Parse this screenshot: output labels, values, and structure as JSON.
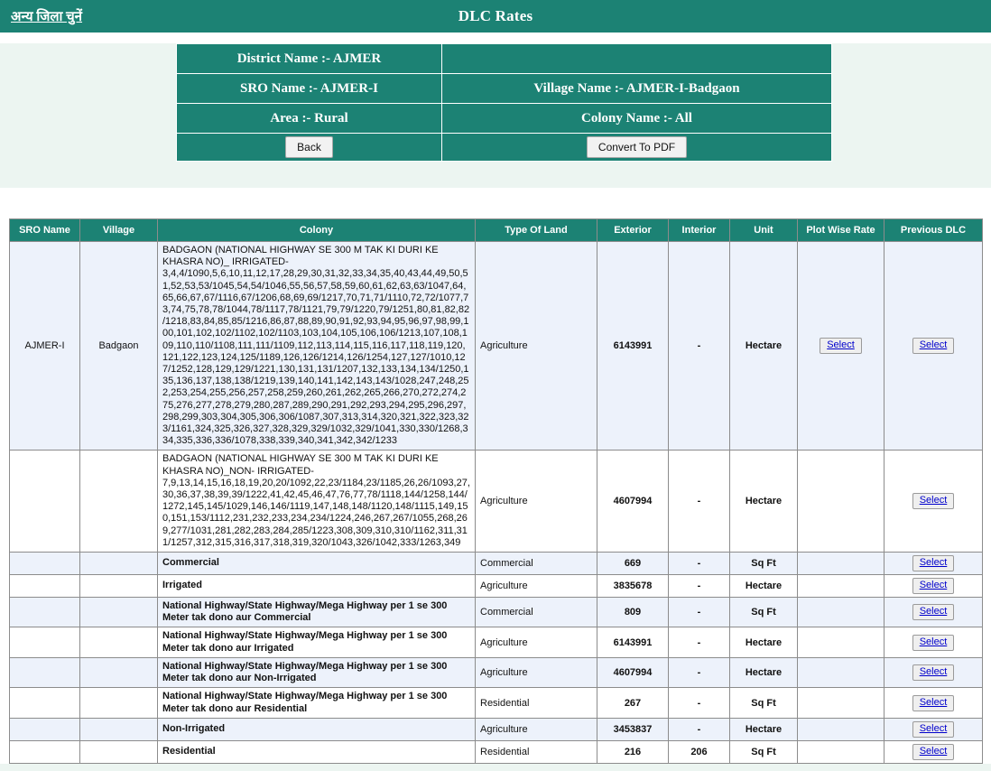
{
  "header": {
    "district_link": "अन्य जिला चुनें",
    "title": "DLC Rates"
  },
  "info": {
    "district": "District Name :- AJMER",
    "blank": "",
    "sro": "SRO Name :- AJMER-I",
    "village": "Village Name :- AJMER-I-Badgaon",
    "area": "Area :- Rural",
    "colony": "Colony Name :- All",
    "back_label": "Back",
    "pdf_label": "Convert To PDF"
  },
  "table": {
    "columns": [
      "SRO Name",
      "Village",
      "Colony",
      "Type Of Land",
      "Exterior",
      "Interior",
      "Unit",
      "Plot Wise Rate",
      "Previous DLC"
    ],
    "select_label": "Select",
    "rows": [
      {
        "sro": "AJMER-I",
        "village": "Badgaon",
        "colony": "BADGAON (NATIONAL HIGHWAY SE 300 M TAK KI DURI KE KHASRA NO)_ IRRIGATED-3,4,4/1090,5,6,10,11,12,17,28,29,30,31,32,33,34,35,40,43,44,49,50,51,52,53,53/1045,54,54/1046,55,56,57,58,59,60,61,62,63,63/1047,64,65,66,67,67/1116,67/1206,68,69,69/1217,70,71,71/1110,72,72/1077,73,74,75,78,78/1044,78/1117,78/1121,79,79/1220,79/1251,80,81,82,82/1218,83,84,85,85/1216,86,87,88,89,90,91,92,93,94,95,96,97,98,99,100,101,102,102/1102,102/1103,103,104,105,106,106/1213,107,108,109,110,110/1108,111,111/1109,112,113,114,115,116,117,118,119,120,121,122,123,124,125/1189,126,126/1214,126/1254,127,127/1010,127/1252,128,129,129/1221,130,131,131/1207,132,133,134,134/1250,135,136,137,138,138/1219,139,140,141,142,143,143/1028,247,248,252,253,254,255,256,257,258,259,260,261,262,265,266,270,272,274,275,276,277,278,279,280,287,289,290,291,292,293,294,295,296,297,298,299,303,304,305,306,306/1087,307,313,314,320,321,322,323,323/1161,324,325,326,327,328,329,329/1032,329/1041,330,330/1268,334,335,336,336/1078,338,339,340,341,342,342/1233",
        "type": "Agriculture",
        "exterior": "6143991",
        "interior": "-",
        "unit": "Hectare",
        "plot_wise_rate": "Select",
        "previous_dlc": "Select",
        "long": true
      },
      {
        "sro": "",
        "village": "",
        "colony": "BADGAON (NATIONAL HIGHWAY SE 300 M TAK KI DURI KE KHASRA NO)_NON- IRRIGATED-7,9,13,14,15,16,18,19,20,20/1092,22,23/1184,23/1185,26,26/1093,27,30,36,37,38,39,39/1222,41,42,45,46,47,76,77,78/1118,144/1258,144/1272,145,145/1029,146,146/1119,147,148,148/1120,148/1115,149,150,151,153/1112,231,232,233,234,234/1224,246,267,267/1055,268,269,277/1031,281,282,283,284,285/1223,308,309,310,310/1162,311,311/1257,312,315,316,317,318,319,320/1043,326/1042,333/1263,349",
        "type": "Agriculture",
        "exterior": "4607994",
        "interior": "-",
        "unit": "Hectare",
        "plot_wise_rate": "",
        "previous_dlc": "Select",
        "long": true
      },
      {
        "sro": "",
        "village": "",
        "colony": "Commercial",
        "type": "Commercial",
        "exterior": "669",
        "interior": "-",
        "unit": "Sq Ft",
        "plot_wise_rate": "",
        "previous_dlc": "Select",
        "long": false
      },
      {
        "sro": "",
        "village": "",
        "colony": "Irrigated",
        "type": "Agriculture",
        "exterior": "3835678",
        "interior": "-",
        "unit": "Hectare",
        "plot_wise_rate": "",
        "previous_dlc": "Select",
        "long": false
      },
      {
        "sro": "",
        "village": "",
        "colony": "National Highway/State Highway/Mega Highway per 1 se 300 Meter tak dono aur Commercial",
        "type": "Commercial",
        "exterior": "809",
        "interior": "-",
        "unit": "Sq Ft",
        "plot_wise_rate": "",
        "previous_dlc": "Select",
        "long": false
      },
      {
        "sro": "",
        "village": "",
        "colony": "National Highway/State Highway/Mega Highway per 1 se 300 Meter tak dono aur Irrigated",
        "type": "Agriculture",
        "exterior": "6143991",
        "interior": "-",
        "unit": "Hectare",
        "plot_wise_rate": "",
        "previous_dlc": "Select",
        "long": false
      },
      {
        "sro": "",
        "village": "",
        "colony": "National Highway/State Highway/Mega Highway per 1 se 300 Meter tak dono aur Non-Irrigated",
        "type": "Agriculture",
        "exterior": "4607994",
        "interior": "-",
        "unit": "Hectare",
        "plot_wise_rate": "",
        "previous_dlc": "Select",
        "long": false
      },
      {
        "sro": "",
        "village": "",
        "colony": "National Highway/State Highway/Mega Highway per 1 se 300 Meter tak dono aur Residential",
        "type": "Residential",
        "exterior": "267",
        "interior": "-",
        "unit": "Sq Ft",
        "plot_wise_rate": "",
        "previous_dlc": "Select",
        "long": false
      },
      {
        "sro": "",
        "village": "",
        "colony": "Non-Irrigated",
        "type": "Agriculture",
        "exterior": "3453837",
        "interior": "-",
        "unit": "Hectare",
        "plot_wise_rate": "",
        "previous_dlc": "Select",
        "long": false
      },
      {
        "sro": "",
        "village": "",
        "colony": "Residential",
        "type": "Residential",
        "exterior": "216",
        "interior": "206",
        "unit": "Sq Ft",
        "plot_wise_rate": "",
        "previous_dlc": "Select",
        "long": false
      }
    ]
  },
  "colors": {
    "teal": "#1c8274",
    "mint": "#ecf5f1",
    "row_alt": "#edf2fb",
    "link_blue": "#0000cc"
  }
}
